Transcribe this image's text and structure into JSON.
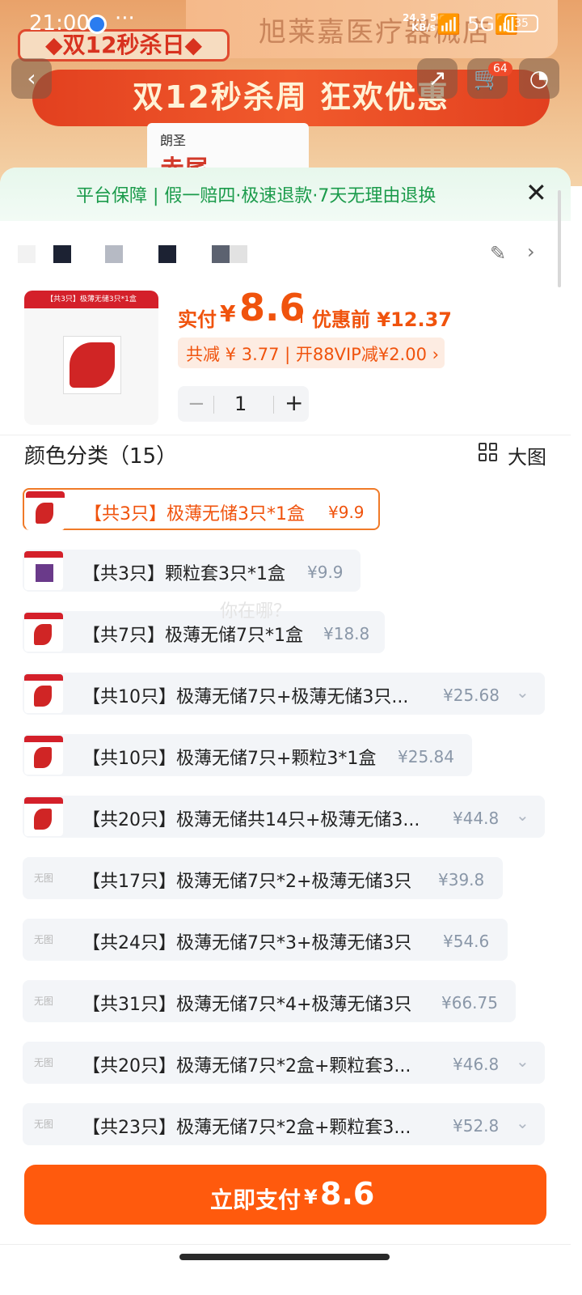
{
  "status_bar": {
    "time": "21:00",
    "more": "···",
    "net_speed": "24.3 5G\nKB/s",
    "signal1": "📶",
    "signal2": "5G📶",
    "battery": "35"
  },
  "background": {
    "shop_name": "旭莱嘉医疗器械店",
    "promo_tag": "◆双12秒杀日◆",
    "promo_banner": "双12秒杀周 狂欢优惠",
    "product_brand": "朗圣",
    "product_name": "赤尾",
    "cart_count": "64"
  },
  "icons": {
    "back": "‹",
    "share": "↗",
    "cart": "🛒",
    "more": "◔",
    "close": "✕",
    "shield": "⛉",
    "edit": "✎",
    "chevron_right": "›",
    "chevron_down": "⌄"
  },
  "guarantee": {
    "text": "平台保障 | 假一赔四·极速退款·7天无理由退换"
  },
  "swatches": [
    "#f2f2f2",
    "#1c2233",
    "#b6bac4",
    "#1c2233",
    "#5c6270",
    "#e2e2e2"
  ],
  "product": {
    "thumb_band": "【共3只】极薄无储3只*1盒",
    "pay_label": "实付",
    "currency": "¥",
    "pay_amount": "8.6",
    "original_price": "优惠前 ¥12.37",
    "discount_text": "共减 ¥ 3.77 | 开88VIP减¥2.00 ›",
    "quantity": "1",
    "qty_minus": "−",
    "qty_plus": "+"
  },
  "section": {
    "title": "颜色分类（15）",
    "view_large": "大图"
  },
  "variants": [
    {
      "label": "【共3只】极薄无储3只*1盒",
      "price": "¥9.9",
      "selected": true,
      "thumb": "flame"
    },
    {
      "label": "【共3只】颗粒套3只*1盒",
      "price": "¥9.9",
      "thumb": "purple"
    },
    {
      "label": "【共7只】极薄无储7只*1盒",
      "price": "¥18.8",
      "thumb": "flame"
    },
    {
      "label": "【共10只】极薄无储7只+极薄无储3只...",
      "price": "¥25.68",
      "thumb": "flame",
      "expand": true
    },
    {
      "label": "【共10只】极薄无储7只+颗粒3*1盒",
      "price": "¥25.84",
      "thumb": "flame"
    },
    {
      "label": "【共20只】极薄无储共14只+极薄无储3...",
      "price": "¥44.8",
      "thumb": "flame",
      "expand": true
    },
    {
      "label": "【共17只】极薄无储7只*2+极薄无储3只",
      "price": "¥39.8",
      "thumb": "none"
    },
    {
      "label": "【共24只】极薄无储7只*3+极薄无储3只",
      "price": "¥54.6",
      "thumb": "none"
    },
    {
      "label": "【共31只】极薄无储7只*4+极薄无储3只",
      "price": "¥66.75",
      "thumb": "none"
    },
    {
      "label": "【共20只】极薄无储7只*2盒+颗粒套3...",
      "price": "¥46.8",
      "thumb": "none",
      "expand": true
    },
    {
      "label": "【共23只】极薄无储7只*2盒+颗粒套3...",
      "price": "¥52.8",
      "thumb": "none",
      "expand": true
    }
  ],
  "no_image_text": "无图",
  "watermark": "你在哪？",
  "pay_button": {
    "label": "立即支付",
    "currency": "¥",
    "amount": "8.6"
  }
}
